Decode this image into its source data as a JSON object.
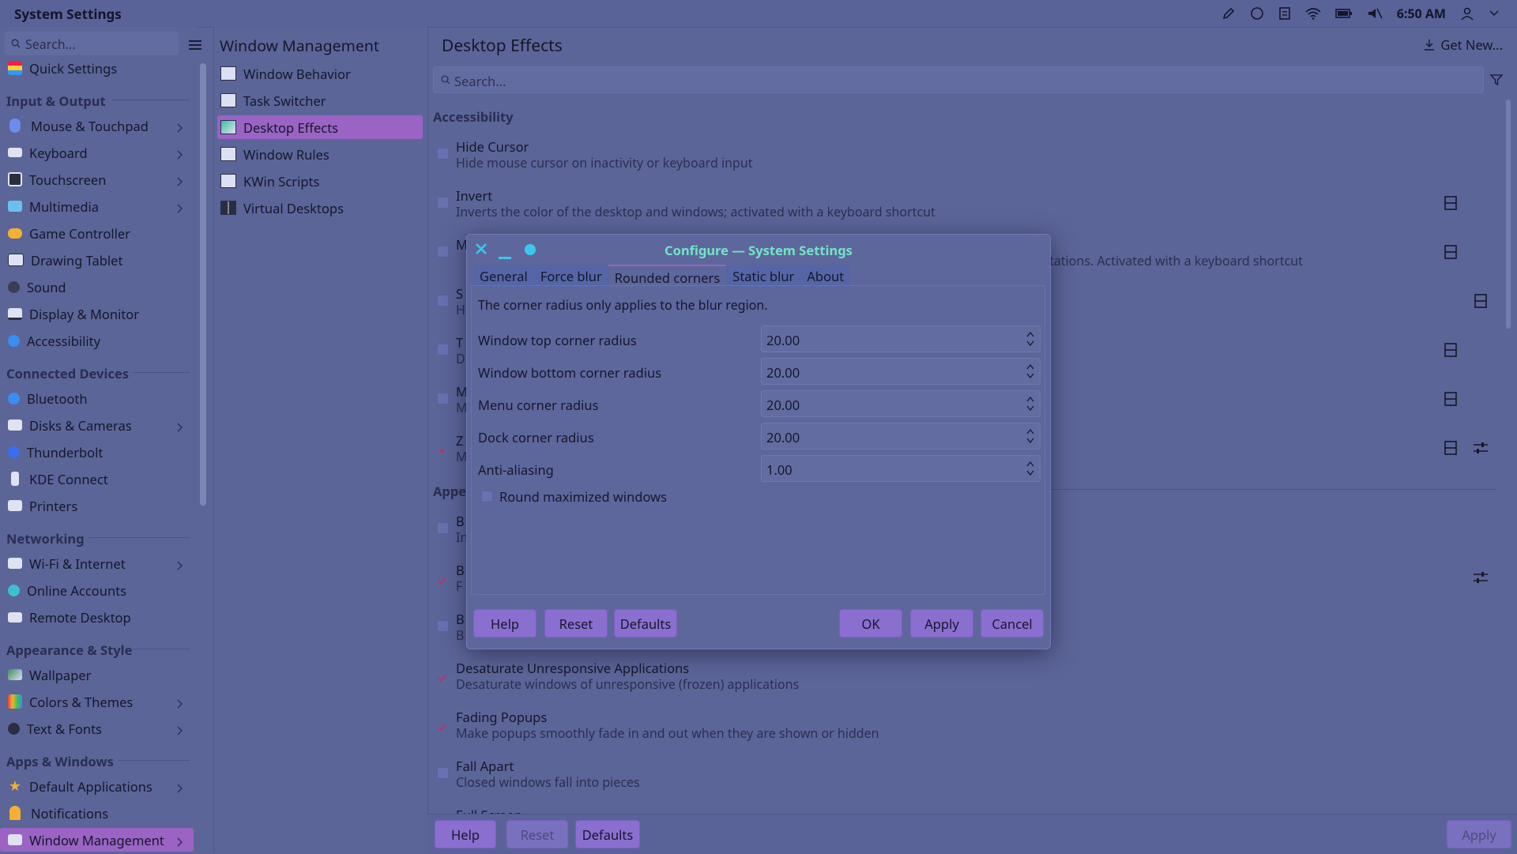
{
  "topbar": {
    "app_title": "System Settings",
    "clock": "6:50 AM"
  },
  "sidebar": {
    "search_placeholder": "Search...",
    "quick_settings": "Quick Settings",
    "sections": {
      "input_output": "Input & Output",
      "connected_devices": "Connected Devices",
      "networking": "Networking",
      "appearance_style": "Appearance & Style",
      "apps_windows": "Apps & Windows"
    },
    "items": {
      "mouse": "Mouse & Touchpad",
      "keyboard": "Keyboard",
      "touchscreen": "Touchscreen",
      "multimedia": "Multimedia",
      "game_controller": "Game Controller",
      "drawing_tablet": "Drawing Tablet",
      "sound": "Sound",
      "display": "Display & Monitor",
      "accessibility": "Accessibility",
      "bluetooth": "Bluetooth",
      "disks": "Disks & Cameras",
      "thunderbolt": "Thunderbolt",
      "kde_connect": "KDE Connect",
      "printers": "Printers",
      "wifi": "Wi-Fi & Internet",
      "online_accounts": "Online Accounts",
      "remote_desktop": "Remote Desktop",
      "wallpaper": "Wallpaper",
      "colors": "Colors & Themes",
      "text_fonts": "Text & Fonts",
      "default_apps": "Default Applications",
      "notifications": "Notifications",
      "window_management": "Window Management"
    }
  },
  "col2": {
    "title": "Window Management",
    "items": {
      "window_behavior": "Window Behavior",
      "task_switcher": "Task Switcher",
      "desktop_effects": "Desktop Effects",
      "window_rules": "Window Rules",
      "kwin_scripts": "KWin Scripts",
      "virtual_desktops": "Virtual Desktops"
    }
  },
  "main": {
    "title": "Desktop Effects",
    "get_new": "Get New...",
    "search_placeholder": "Search...",
    "section_accessibility": "Accessibility",
    "section_appearance_partial": "Appe",
    "effects": {
      "hide_cursor_t": "Hide Cursor",
      "hide_cursor_d": "Hide mouse cursor on inactivity or keyboard input",
      "invert_t": "Invert",
      "invert_d": "Inverts the color of the desktop and windows; activated with a keyboard shortcut",
      "m1_t": "M",
      "m1_tail": "tations. Activated with a keyboard shortcut",
      "s_t": "S",
      "s_d": "H",
      "t_t": "T",
      "t_d": "D",
      "m2_t": "M",
      "m2_d": "M",
      "z_t": "Z",
      "z_d": "M",
      "b1_t": "B",
      "b1_d": "In",
      "b2_t": "B",
      "b2_d": "F",
      "b3_t": "B",
      "b3_d": "B",
      "desat_t": "Desaturate Unresponsive Applications",
      "desat_d": "Desaturate windows of unresponsive (frozen) applications",
      "fading_t": "Fading Popups",
      "fading_d": "Make popups smoothly fade in and out when they are shown or hidden",
      "fall_t": "Fall Apart",
      "fall_d": "Closed windows fall into pieces",
      "full_t": "Full Screen"
    }
  },
  "bottombar": {
    "help": "Help",
    "reset": "Reset",
    "defaults": "Defaults",
    "apply": "Apply"
  },
  "dialog": {
    "title": "Configure — System Settings",
    "tabs": {
      "general": "General",
      "force_blur": "Force blur",
      "rounded": "Rounded corners",
      "static_blur": "Static blur",
      "about": "About"
    },
    "note": "The corner radius only applies to the blur region.",
    "fields": {
      "top_label": "Window top corner radius",
      "top_value": "20.00",
      "bottom_label": "Window bottom corner radius",
      "bottom_value": "20.00",
      "menu_label": "Menu corner radius",
      "menu_value": "20.00",
      "dock_label": "Dock corner radius",
      "dock_value": "20.00",
      "aa_label": "Anti-aliasing",
      "aa_value": "1.00"
    },
    "round_max": "Round maximized windows",
    "buttons": {
      "help": "Help",
      "reset": "Reset",
      "defaults": "Defaults",
      "ok": "OK",
      "apply": "Apply",
      "cancel": "Cancel"
    }
  }
}
